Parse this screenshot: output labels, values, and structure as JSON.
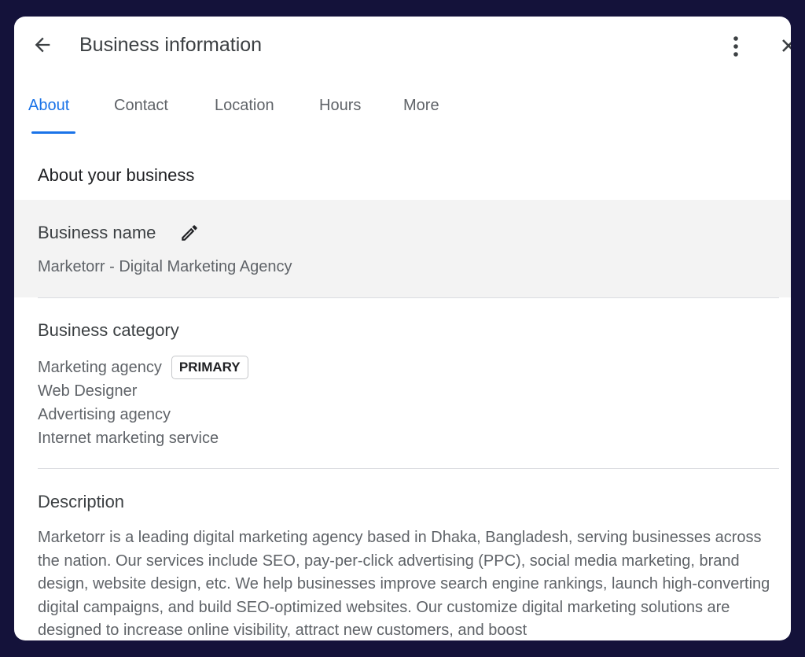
{
  "header": {
    "title": "Business information"
  },
  "tabs": [
    {
      "label": "About",
      "active": true
    },
    {
      "label": "Contact",
      "active": false
    },
    {
      "label": "Location",
      "active": false
    },
    {
      "label": "Hours",
      "active": false
    },
    {
      "label": "More",
      "active": false
    }
  ],
  "about": {
    "section_title": "About your business",
    "business_name": {
      "label": "Business name",
      "value": "Marketorr - Digital Marketing Agency"
    },
    "category": {
      "label": "Business category",
      "items": [
        "Marketing agency",
        "Web Designer",
        "Advertising agency",
        "Internet marketing service"
      ],
      "primary_badge": "PRIMARY"
    },
    "description": {
      "label": "Description",
      "text": "Marketorr is a leading digital marketing agency based in Dhaka, Bangladesh, serving businesses across the nation. Our services include SEO, pay-per-click advertising (PPC), social media marketing, brand design, website design, etc. We help businesses improve search engine rankings, launch high-converting digital campaigns, and build SEO-optimized websites. Our customize digital marketing solutions are designed to increase online visibility, attract new customers, and boost"
    }
  },
  "colors": {
    "accent": "#1a73e8",
    "background": "#14123a",
    "highlight_row": "#f3f3f3"
  },
  "icons": {
    "back": "arrow-back-icon",
    "more": "more-vert-icon",
    "close": "close-icon",
    "edit": "pencil-icon"
  }
}
